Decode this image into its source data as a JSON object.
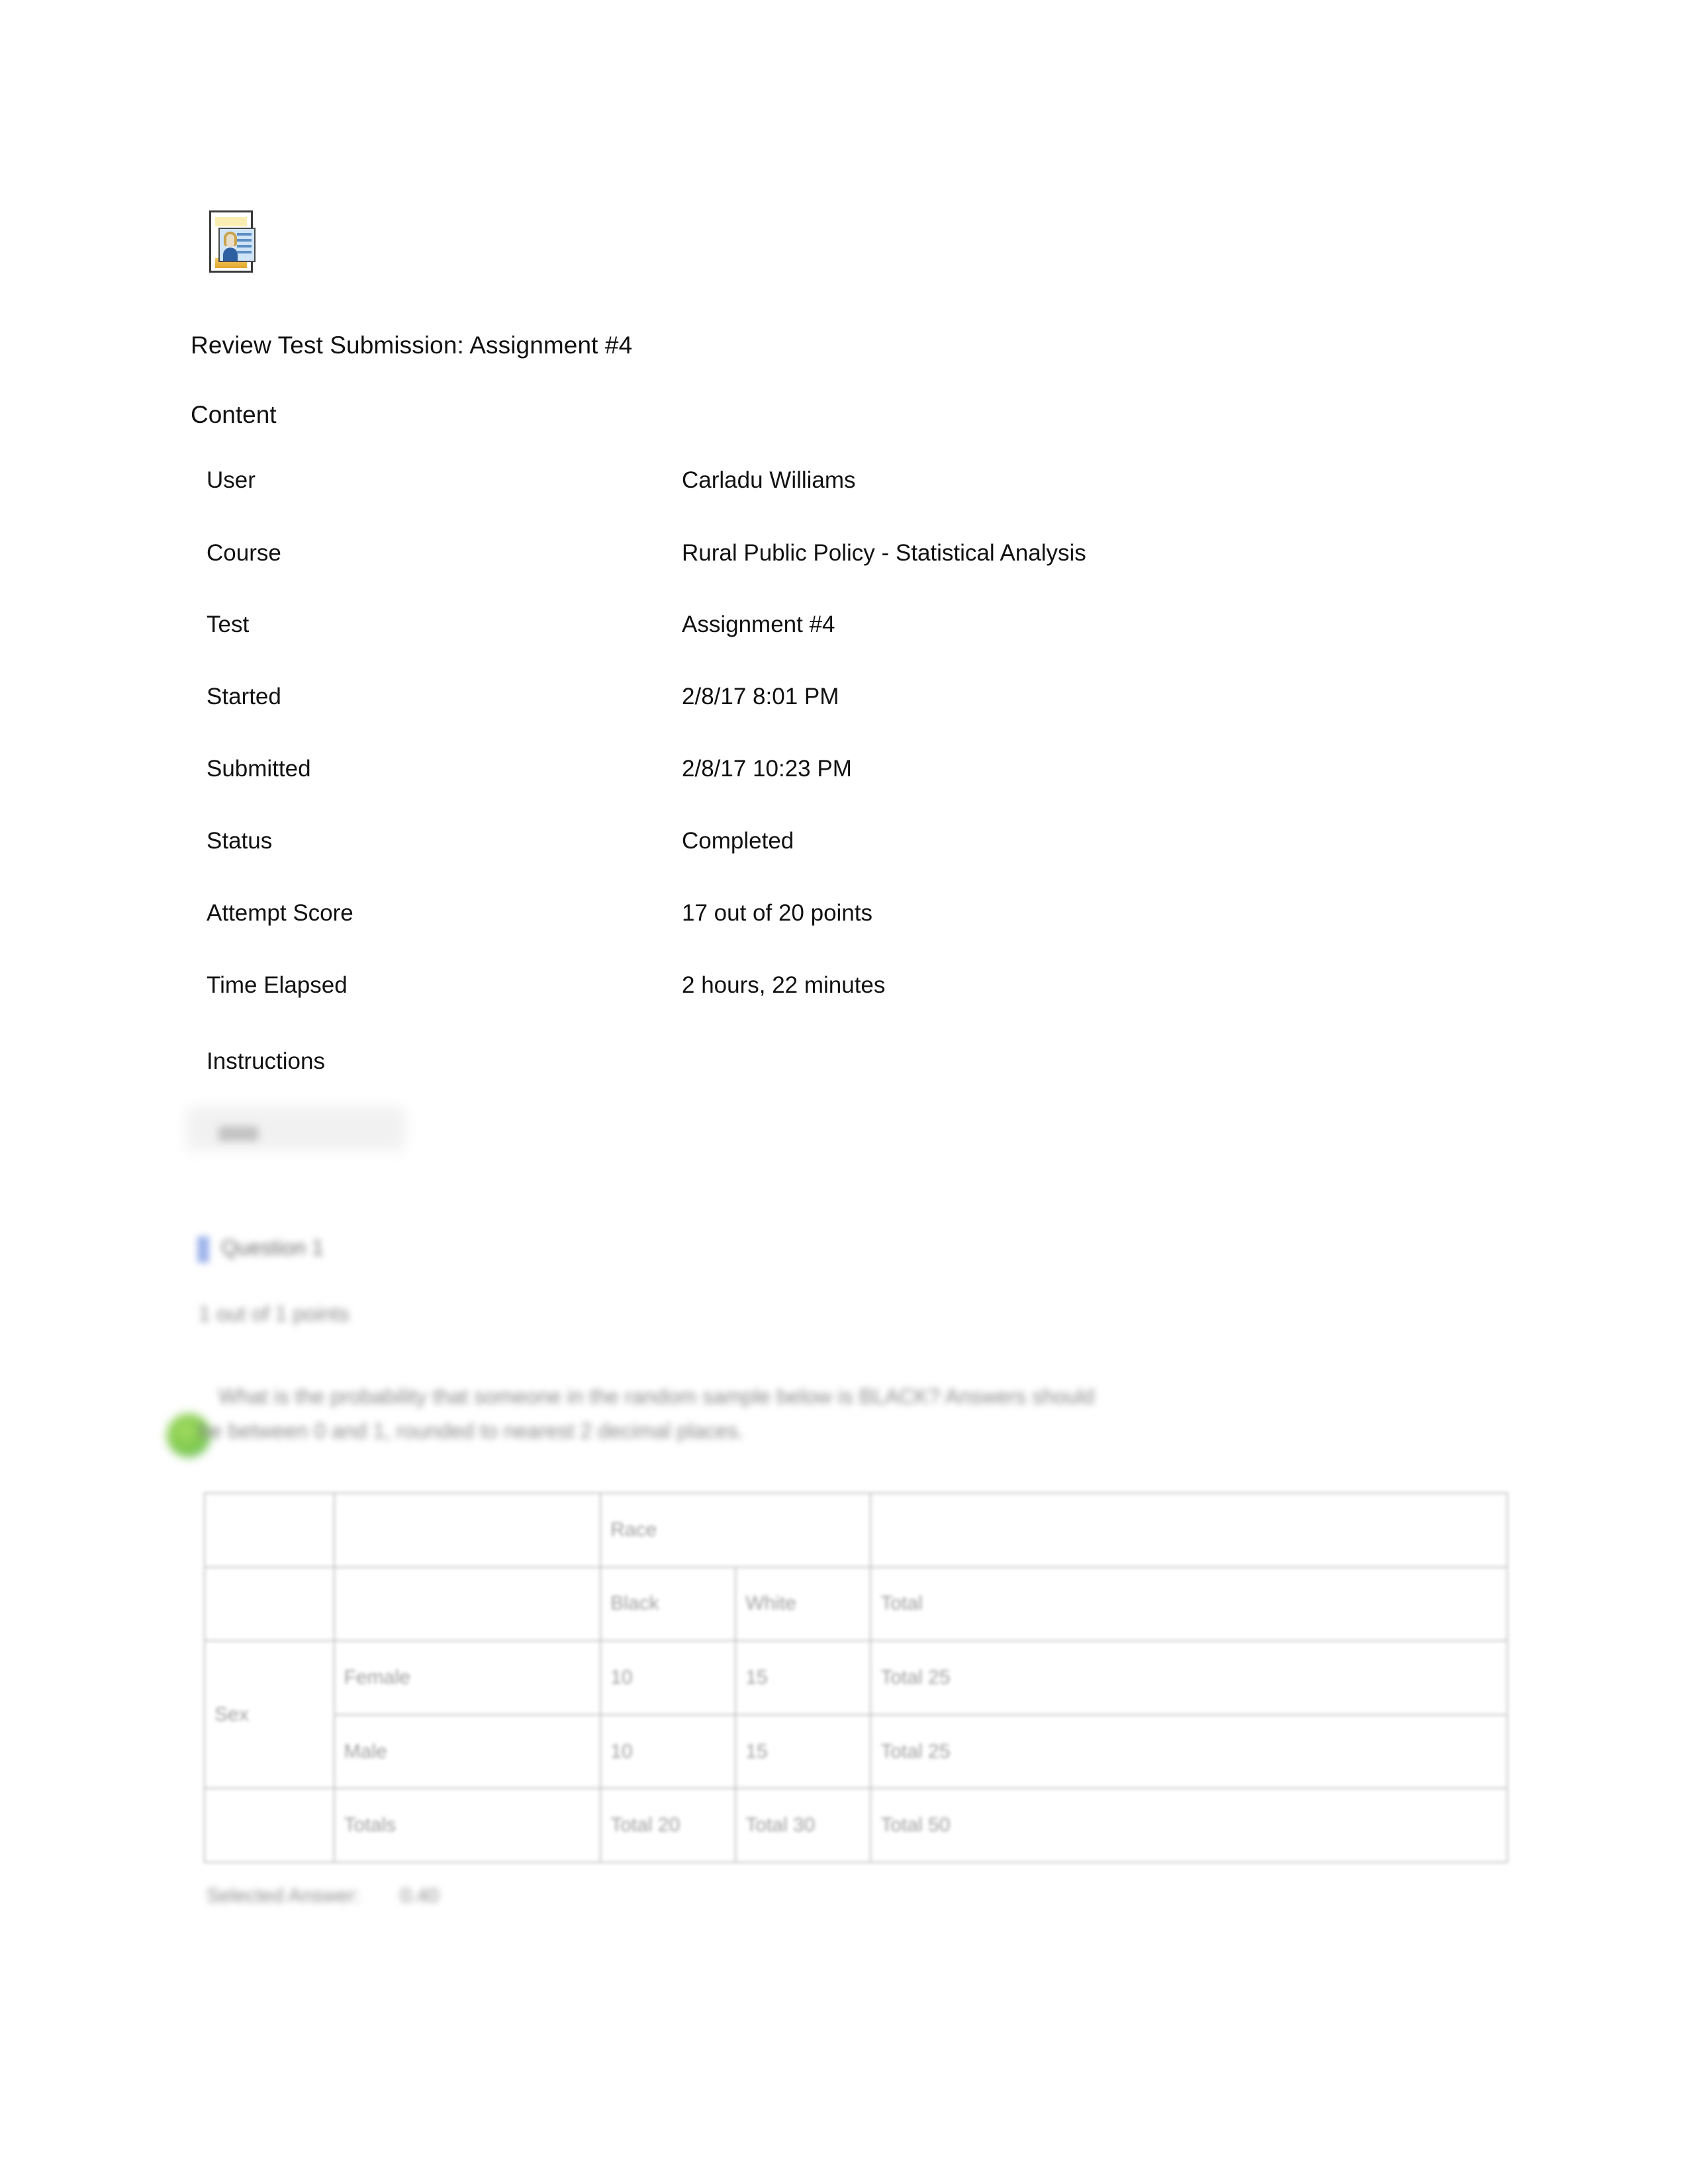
{
  "document": {
    "icon_name": "user-id-card-document-icon",
    "title": "Review Test Submission: Assignment #4",
    "section_heading": "Content"
  },
  "details": [
    {
      "label": "User",
      "value": "Carladu Williams"
    },
    {
      "label": "Course",
      "value": "Rural Public Policy - Statistical Analysis"
    },
    {
      "label": "Test",
      "value": "Assignment #4"
    },
    {
      "label": "Started",
      "value": "2/8/17 8:01 PM"
    },
    {
      "label": "Submitted",
      "value": "2/8/17 10:23 PM"
    },
    {
      "label": "Status",
      "value": "Completed"
    },
    {
      "label": "Attempt Score",
      "value": "17 out of 20 points"
    },
    {
      "label": "Time Elapsed",
      "value": "2 hours, 22 minutes"
    }
  ],
  "instructions": {
    "heading": "Instructions",
    "panel_redacted": true
  },
  "question": {
    "header_label": "Question 1",
    "points_label": "1 out of 1 points",
    "status_marker": "correct-green-circle",
    "text_line_1": "What is the probability that someone in the random sample below is BLACK?  Answers should",
    "text_line_2": "be between 0 and 1, rounded to nearest 2 decimal places.",
    "selected_answer_label": "Selected Answer:",
    "selected_answer_value": "0.40"
  },
  "table": {
    "rows": [
      {
        "cells": [
          {
            "text": "",
            "col": 0
          },
          {
            "text": "",
            "col": 1
          },
          {
            "text": "Race",
            "col": 2,
            "span": 2
          },
          {
            "text": "",
            "col": 4
          }
        ]
      },
      {
        "cells": [
          {
            "text": "",
            "col": 0
          },
          {
            "text": "",
            "col": 1
          },
          {
            "text": "Black",
            "col": 2
          },
          {
            "text": "White",
            "col": 3
          },
          {
            "text": "Total",
            "col": 4
          }
        ]
      },
      {
        "cells": [
          {
            "text": "Sex",
            "col": 0,
            "rowspan": 2
          },
          {
            "text": "Female",
            "col": 1
          },
          {
            "text": "10",
            "col": 2
          },
          {
            "text": "15",
            "col": 3
          },
          {
            "text": "Total 25",
            "col": 4
          }
        ]
      },
      {
        "cells": [
          {
            "text": "Male",
            "col": 1
          },
          {
            "text": "10",
            "col": 2
          },
          {
            "text": "15",
            "col": 3
          },
          {
            "text": "Total 25",
            "col": 4
          }
        ]
      },
      {
        "cells": [
          {
            "text": "",
            "col": 0
          },
          {
            "text": "Totals",
            "col": 1
          },
          {
            "text": "Total 20",
            "col": 2
          },
          {
            "text": "Total 30",
            "col": 3
          },
          {
            "text": "Total 50",
            "col": 4
          }
        ]
      }
    ]
  },
  "colors": {
    "text": "#111111",
    "redacted_text": "#8a8a8a",
    "correct_green": "#7ec944",
    "question_icon_blue": "#8fa8e8",
    "table_border": "#b9b9b9"
  }
}
